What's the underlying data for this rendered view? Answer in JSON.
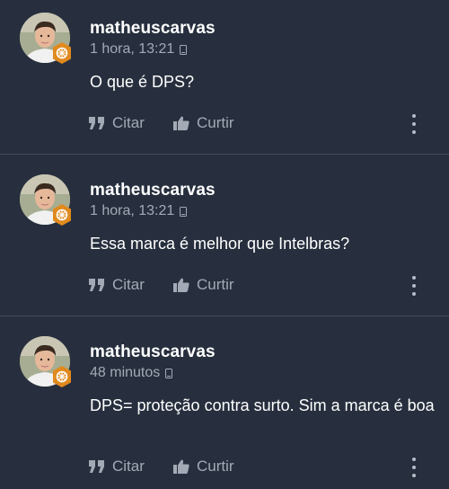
{
  "posts": [
    {
      "author": "matheuscarvas",
      "time": "1 hora, 13:21",
      "content": "O que é DPS?",
      "quote_label": "Citar",
      "like_label": "Curtir"
    },
    {
      "author": "matheuscarvas",
      "time": "1 hora, 13:21",
      "content": "Essa marca é melhor que Intelbras?",
      "quote_label": "Citar",
      "like_label": "Curtir"
    },
    {
      "author": "matheuscarvas",
      "time": "48 minutos",
      "content": "DPS= proteção contra surto. Sim a marca é boa",
      "quote_label": "Citar",
      "like_label": "Curtir"
    }
  ],
  "icons": {
    "quote": "quote-icon",
    "like": "thumbs-up-icon",
    "more": "more-vertical-icon",
    "device": "mobile-device-icon",
    "badge": "rank-badge-icon"
  },
  "colors": {
    "background": "#272f3e",
    "muted_text": "#a3aab6",
    "divider": "#434b59",
    "badge": "#e08a1e"
  }
}
